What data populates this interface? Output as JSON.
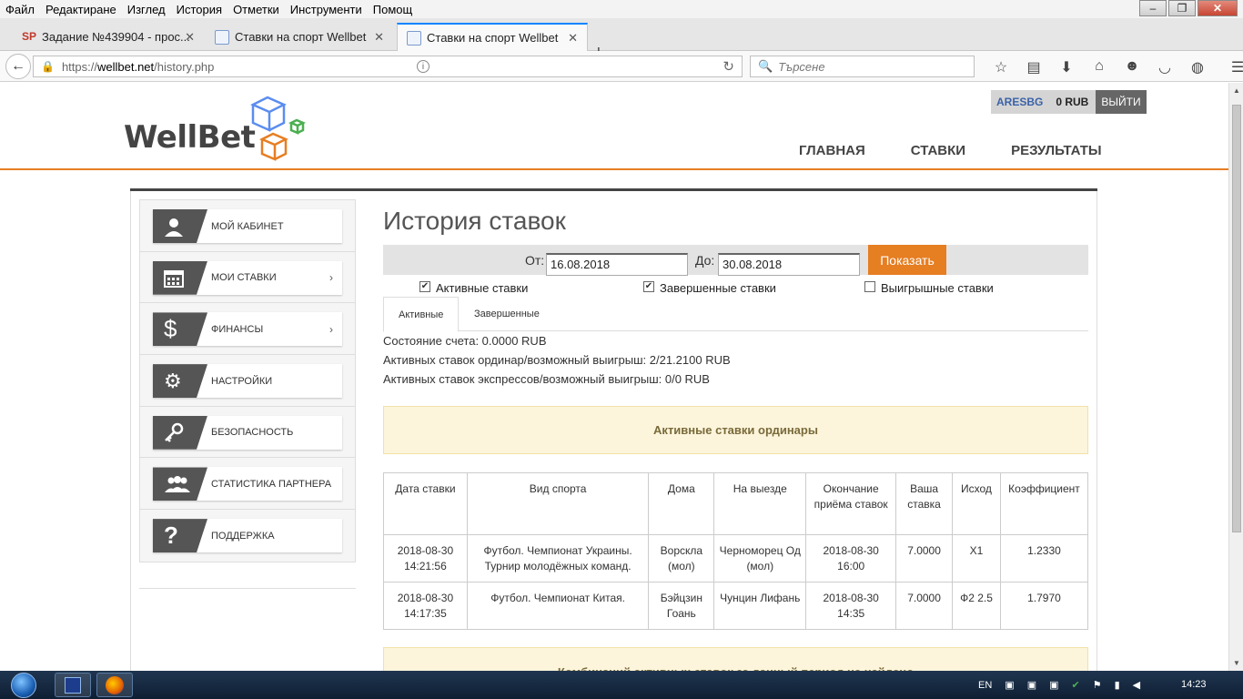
{
  "browser": {
    "menu": [
      "Файл",
      "Редактиране",
      "Изглед",
      "История",
      "Отметки",
      "Инструменти",
      "Помощ"
    ],
    "tabs": [
      {
        "title": "Задание №439904 - прос..."
      },
      {
        "title": "Ставки на спорт Wellbet"
      },
      {
        "title": "Ставки на спорт Wellbet"
      }
    ],
    "url_scheme": "https://",
    "url_host": "wellbet.net",
    "url_path": "/history.php",
    "search_placeholder": "Търсене"
  },
  "header": {
    "logo_text": "WellBet",
    "username": "ARESBG",
    "balance": "0 RUB",
    "logout": "ВЫЙТИ",
    "nav": [
      "ГЛАВНАЯ",
      "СТАВКИ",
      "РЕЗУЛЬТАТЫ"
    ]
  },
  "sidebar": {
    "items": [
      {
        "label": "МОЙ КАБИНЕТ",
        "icon": "user-icon",
        "chevron": ""
      },
      {
        "label": "МОИ СТАВКИ",
        "icon": "calendar-icon",
        "chevron": "›"
      },
      {
        "label": "ФИНАНСЫ",
        "icon": "dollar-icon",
        "chevron": "›"
      },
      {
        "label": "НАСТРОЙКИ",
        "icon": "gears-icon",
        "chevron": ""
      },
      {
        "label": "БЕЗОПАСНОСТЬ",
        "icon": "key-icon",
        "chevron": ""
      },
      {
        "label": "СТАТИСТИКА ПАРТНЕРА",
        "icon": "group-icon",
        "chevron": ""
      },
      {
        "label": "ПОДДЕРЖКА",
        "icon": "question-icon",
        "chevron": ""
      }
    ]
  },
  "main": {
    "title": "История ставок",
    "from_label": "От:",
    "from_value": "16.08.2018",
    "to_label": "До:",
    "to_value": "30.08.2018",
    "show_button": "Показать",
    "checkboxes": [
      {
        "label": "Активные ставки",
        "checked": true
      },
      {
        "label": "Завершенные ставки",
        "checked": true
      },
      {
        "label": "Выигрышные ставки",
        "checked": false
      }
    ],
    "tabs": [
      "Активные",
      "Завершенные"
    ],
    "account_state": "Состояние счета: 0.0000 RUB",
    "active_singles": "Активных ставок ординар/возможный выигрыш: 2/21.2100 RUB",
    "active_express": "Активных ставок экспрессов/возможный выигрыш: 0/0 RUB",
    "singles_header": "Активные ставки ординары",
    "combos_notice": "Комбинаций активных ставок за данный период не найдено",
    "table": {
      "columns": [
        "Дата ставки",
        "Вид спорта",
        "Дома",
        "На выезде",
        "Окончание приёма ставок",
        "Ваша ставка",
        "Исход",
        "Коэффициент"
      ],
      "rows": [
        [
          "2018-08-30 14:21:56",
          "Футбол. Чемпионат Украины. Турнир молодёжных команд.",
          "Ворскла (мол)",
          "Черноморец Од (мол)",
          "2018-08-30 16:00",
          "7.0000",
          "X1",
          "1.2330"
        ],
        [
          "2018-08-30 14:17:35",
          "Футбол. Чемпионат Китая.",
          "Бэйцзин Гоань",
          "Чунцин Лифань",
          "2018-08-30 14:35",
          "7.0000",
          "Ф2 2.5",
          "1.7970"
        ]
      ]
    }
  },
  "taskbar": {
    "lang": "EN",
    "time": "14:23"
  },
  "colors": {
    "accent": "#e67e22",
    "notice_bg": "#fcf5dc"
  }
}
